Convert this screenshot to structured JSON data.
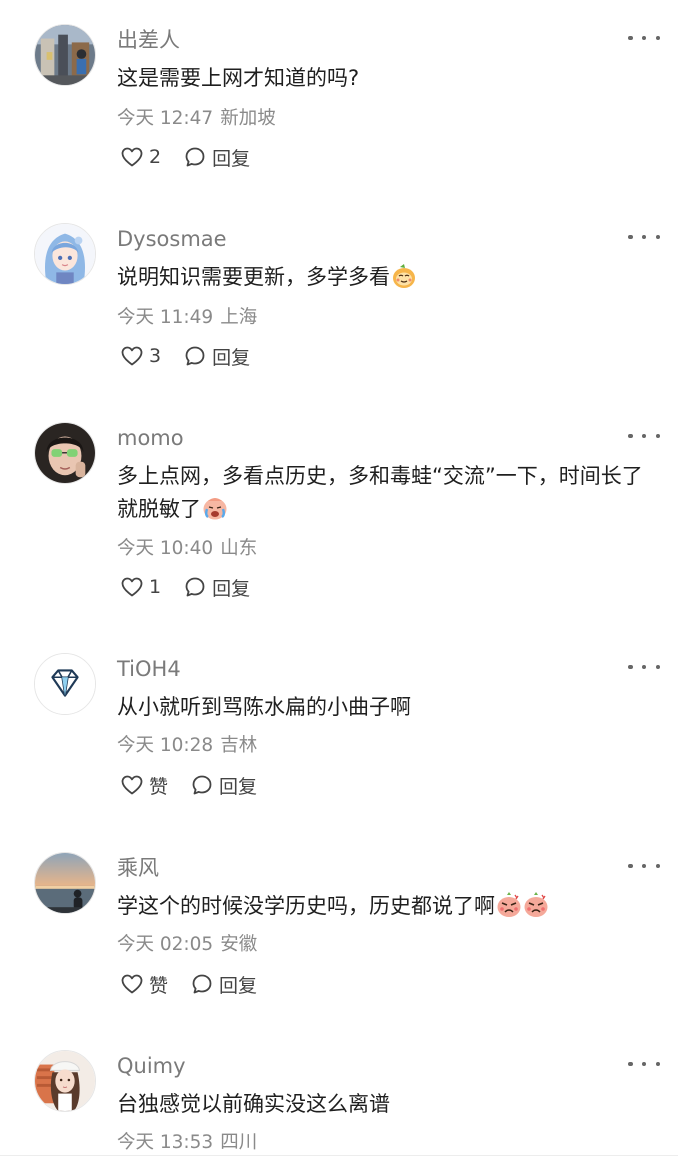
{
  "comments": [
    {
      "user": "出差人",
      "avatar": "avatar-street-photo",
      "text": "这是需要上网才知道的吗?",
      "emojis": [],
      "time": "今天 12:47",
      "location": "新加坡",
      "like_label": "2",
      "reply_label": "回复"
    },
    {
      "user": "Dysosmae",
      "avatar": "avatar-anime-girl-blue-hair",
      "text": "说明知识需要更新，多学多看",
      "emojis": [
        "smug-face-emoji"
      ],
      "time": "今天 11:49",
      "location": "上海",
      "like_label": "3",
      "reply_label": "回复"
    },
    {
      "user": "momo",
      "avatar": "avatar-person-green-glasses",
      "text": "多上点网，多看点历史，多和毒蛙“交流”一下，时间长了就脱敏了",
      "emojis": [
        "crying-face-emoji"
      ],
      "time": "今天 10:40",
      "location": "山东",
      "like_label": "1",
      "reply_label": "回复"
    },
    {
      "user": "TiOH4",
      "avatar": "avatar-diamond",
      "text": "从小就听到骂陈水扁的小曲子啊",
      "emojis": [],
      "time": "今天 10:28",
      "location": "吉林",
      "like_label": "赞",
      "reply_label": "回复"
    },
    {
      "user": "乘风",
      "avatar": "avatar-sunset-beach",
      "text": "学这个的时候没学历史吗，历史都说了啊",
      "emojis": [
        "angry-face-emoji",
        "angry-face-emoji"
      ],
      "time": "今天 02:05",
      "location": "安徽",
      "like_label": "赞",
      "reply_label": "回复"
    },
    {
      "user": "Quimy",
      "avatar": "avatar-girl-white-hat",
      "text": "台独感觉以前确实没这么离谱",
      "emojis": [],
      "time": "今天 13:53",
      "location": "四川",
      "like_label": "",
      "reply_label": ""
    }
  ],
  "colors": {
    "username": "#7a7a7a",
    "text": "#1f1f1f",
    "meta": "#8a8a8a",
    "icon": "#444444"
  }
}
